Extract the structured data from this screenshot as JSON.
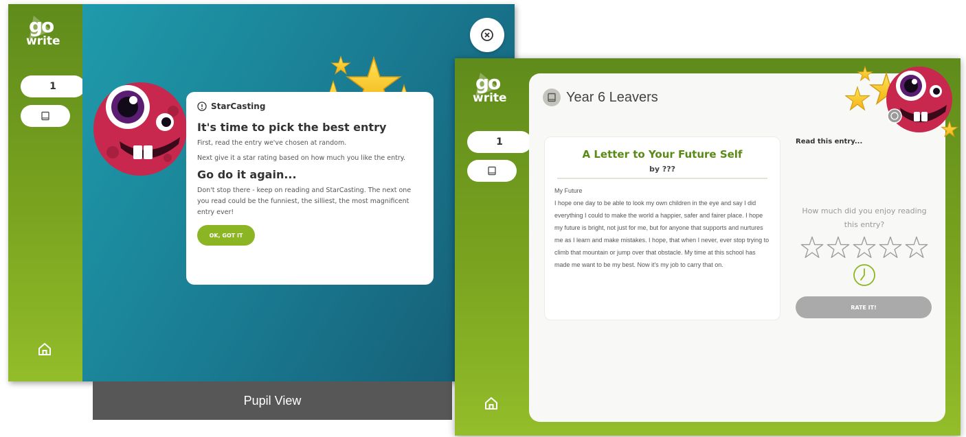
{
  "pupil": {
    "rail": {
      "logo_top": "go",
      "logo_bottom": "write",
      "level": "1"
    },
    "popup": {
      "header": "StarCasting",
      "title": "It's time to pick the best entry",
      "p1": "First, read the entry we've chosen at random.",
      "p2": "Next give it a star rating based on how much you like the entry.",
      "title2": "Go do it again...",
      "p3": "Don't stop there - keep on reading and StarCasting. The next one you read could be the funniest, the silliest, the most magnificent entry ever!",
      "button": "OK, GOT IT"
    },
    "caption": "Pupil View"
  },
  "reader": {
    "rail": {
      "logo_top": "go",
      "logo_bottom": "write",
      "level": "1"
    },
    "title": "Year 6 Leavers",
    "entry": {
      "title": "A Letter to Your Future Self",
      "author": "by ???",
      "subtitle": "My Future",
      "body": "I hope one day to be able to look my own children in the eye and say I did everything I could to make the world a happier, safer and fairer place. I hope my future is bright, not just for me, but for anyone that supports and nurtures me as I learn and make mistakes. I hope, that when I never, ever stop trying to climb that mountain or jump over that obstacle. My time at this school has made me want to be my best. Now it's my job to carry that on."
    },
    "side": {
      "read_label": "Read this entry...",
      "question": "How much did you enjoy reading this entry?",
      "rating": 0,
      "rating_max": 5,
      "button": "RATE IT!"
    }
  },
  "colors": {
    "green": "#7aa41f",
    "teal": "#1a8aa0",
    "accent": "#8cb524",
    "star": "#f5c51a",
    "monster": "#c8284d"
  },
  "icons": [
    "go-write-logo",
    "book-icon",
    "home-icon",
    "close-icon",
    "info-icon",
    "star-icon",
    "clock-icon",
    "monster-mascot"
  ]
}
